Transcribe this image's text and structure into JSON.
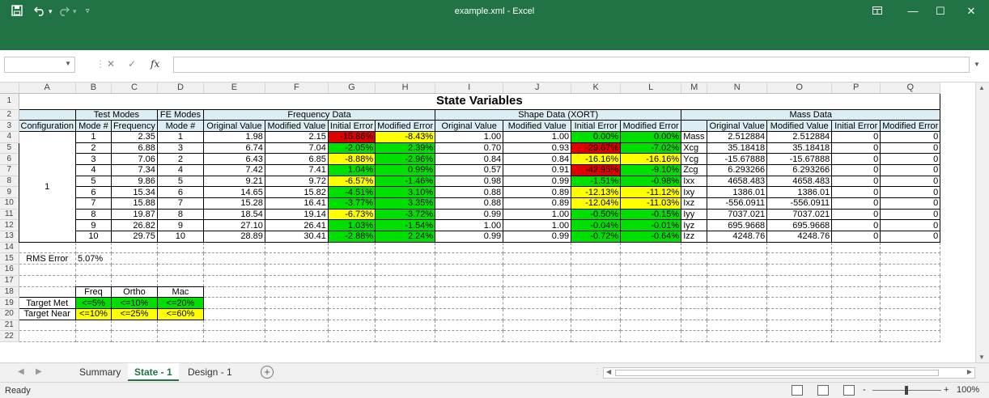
{
  "window": {
    "title": "example.xml  -  Excel",
    "save_icon": "save-icon",
    "undo_icon": "undo-icon",
    "redo_icon": "redo-icon",
    "minimize": "—",
    "maximize": "☐",
    "close": "✕",
    "restore_icon": "ribbon-display-icon"
  },
  "formula_bar": {
    "name_box": "",
    "formula": "",
    "cancel": "✕",
    "enter": "✓",
    "fx": "fx"
  },
  "columns": [
    "A",
    "B",
    "C",
    "D",
    "E",
    "F",
    "G",
    "H",
    "I",
    "J",
    "K",
    "L",
    "M",
    "N",
    "O",
    "P",
    "Q"
  ],
  "rows": [
    "1",
    "2",
    "3",
    "4",
    "5",
    "6",
    "7",
    "8",
    "9",
    "10",
    "11",
    "12",
    "13",
    "14",
    "15",
    "16",
    "17",
    "18",
    "19",
    "20",
    "21",
    "22"
  ],
  "sheet": {
    "title": "State Variables",
    "group_test_modes": "Test Modes",
    "group_fe_modes": "FE Modes",
    "group_frequency": "Frequency Data",
    "group_shape": "Shape Data (XORT)",
    "group_mass": "Mass Data",
    "headers": [
      "Configuration",
      "Mode #",
      "Frequency",
      "Mode #",
      "Original Value",
      "Modified Value",
      "Initial Error",
      "Modified Error",
      "Original Value",
      "Modified Value",
      "Initial Error",
      "Modified Error",
      "",
      "Original Value",
      "Modified Value",
      "Initial Error",
      "Modified Error"
    ],
    "configuration": "1",
    "data_rows": [
      {
        "b": "1",
        "c": "2.35",
        "d": "1",
        "e": "1.98",
        "f": "2.15",
        "g": "-15.86%",
        "h": "-8.43%",
        "i": "1.00",
        "j": "1.00",
        "k": "0.00%",
        "l": "0.00%",
        "m": "Mass",
        "n": "2.512884",
        "o": "2.512884",
        "p": "0",
        "q": "0",
        "gc": "rd",
        "hc": "yl",
        "kc": "gr",
        "lc": "gr"
      },
      {
        "b": "2",
        "c": "6.88",
        "d": "3",
        "e": "6.74",
        "f": "7.04",
        "g": "-2.05%",
        "h": "2.39%",
        "i": "0.70",
        "j": "0.93",
        "k": "-29.67%",
        "l": "-7.02%",
        "m": "Xcg",
        "n": "35.18418",
        "o": "35.18418",
        "p": "0",
        "q": "0",
        "gc": "gr",
        "hc": "gr",
        "kc": "rd",
        "lc": "gr"
      },
      {
        "b": "3",
        "c": "7.06",
        "d": "2",
        "e": "6.43",
        "f": "6.85",
        "g": "-8.88%",
        "h": "-2.96%",
        "i": "0.84",
        "j": "0.84",
        "k": "-16.16%",
        "l": "-16.16%",
        "m": "Ycg",
        "n": "-15.67888",
        "o": "-15.67888",
        "p": "0",
        "q": "0",
        "gc": "yl",
        "hc": "gr",
        "kc": "yl",
        "lc": "yl"
      },
      {
        "b": "4",
        "c": "7.34",
        "d": "4",
        "e": "7.42",
        "f": "7.41",
        "g": "1.04%",
        "h": "0.99%",
        "i": "0.57",
        "j": "0.91",
        "k": "-42.95%",
        "l": "-9.10%",
        "m": "Zcg",
        "n": "6.293266",
        "o": "6.293266",
        "p": "0",
        "q": "0",
        "gc": "gr",
        "hc": "gr",
        "kc": "rd",
        "lc": "gr"
      },
      {
        "b": "5",
        "c": "9.86",
        "d": "5",
        "e": "9.21",
        "f": "9.72",
        "g": "-6.57%",
        "h": "-1.46%",
        "i": "0.98",
        "j": "0.99",
        "k": "-1.51%",
        "l": "-0.98%",
        "m": "Ixx",
        "n": "4658.483",
        "o": "4658.483",
        "p": "0",
        "q": "0",
        "gc": "yl",
        "hc": "gr",
        "kc": "gr",
        "lc": "gr"
      },
      {
        "b": "6",
        "c": "15.34",
        "d": "6",
        "e": "14.65",
        "f": "15.82",
        "g": "-4.51%",
        "h": "3.10%",
        "i": "0.88",
        "j": "0.89",
        "k": "-12.13%",
        "l": "-11.12%",
        "m": "Ixy",
        "n": "1386.01",
        "o": "1386.01",
        "p": "0",
        "q": "0",
        "gc": "gr",
        "hc": "gr",
        "kc": "yl",
        "lc": "yl"
      },
      {
        "b": "7",
        "c": "15.88",
        "d": "7",
        "e": "15.28",
        "f": "16.41",
        "g": "-3.77%",
        "h": "3.35%",
        "i": "0.88",
        "j": "0.89",
        "k": "-12.04%",
        "l": "-11.03%",
        "m": "Ixz",
        "n": "-556.0911",
        "o": "-556.0911",
        "p": "0",
        "q": "0",
        "gc": "gr",
        "hc": "gr",
        "kc": "yl",
        "lc": "yl"
      },
      {
        "b": "8",
        "c": "19.87",
        "d": "8",
        "e": "18.54",
        "f": "19.14",
        "g": "-6.73%",
        "h": "-3.72%",
        "i": "0.99",
        "j": "1.00",
        "k": "-0.50%",
        "l": "-0.15%",
        "m": "Iyy",
        "n": "7037.021",
        "o": "7037.021",
        "p": "0",
        "q": "0",
        "gc": "yl",
        "hc": "gr",
        "kc": "gr",
        "lc": "gr"
      },
      {
        "b": "9",
        "c": "26.82",
        "d": "9",
        "e": "27.10",
        "f": "26.41",
        "g": "1.03%",
        "h": "-1.54%",
        "i": "1.00",
        "j": "1.00",
        "k": "-0.04%",
        "l": "-0.01%",
        "m": "Iyz",
        "n": "695.9668",
        "o": "695.9668",
        "p": "0",
        "q": "0",
        "gc": "gr",
        "hc": "gr",
        "kc": "gr",
        "lc": "gr"
      },
      {
        "b": "10",
        "c": "29.75",
        "d": "10",
        "e": "28.89",
        "f": "30.41",
        "g": "-2.88%",
        "h": "2.24%",
        "i": "0.99",
        "j": "0.99",
        "k": "-0.72%",
        "l": "-0.64%",
        "m": "Izz",
        "n": "4248.76",
        "o": "4248.76",
        "p": "0",
        "q": "0",
        "gc": "gr",
        "hc": "gr",
        "kc": "gr",
        "lc": "gr"
      }
    ],
    "rms_label": "RMS Error",
    "rms_value": "5.07%",
    "legend_headers": [
      "Freq",
      "Ortho",
      "Mac"
    ],
    "target_met_label": "Target Met",
    "target_met": [
      "<=5%",
      "<=10%",
      "<=20%"
    ],
    "target_near_label": "Target Near",
    "target_near": [
      "<=10%",
      "<=25%",
      "<=60%"
    ]
  },
  "tabs": [
    {
      "label": "Summary",
      "active": false
    },
    {
      "label": "State - 1",
      "active": true
    },
    {
      "label": "Design - 1",
      "active": false
    }
  ],
  "status": {
    "ready": "Ready",
    "zoom": "100%",
    "zoom_minus": "-",
    "zoom_plus": "+"
  },
  "colors": {
    "excel_green": "#217346",
    "header_cyan": "#daeef3",
    "good": "#00e000",
    "near": "#ffff00",
    "bad": "#e00000"
  }
}
